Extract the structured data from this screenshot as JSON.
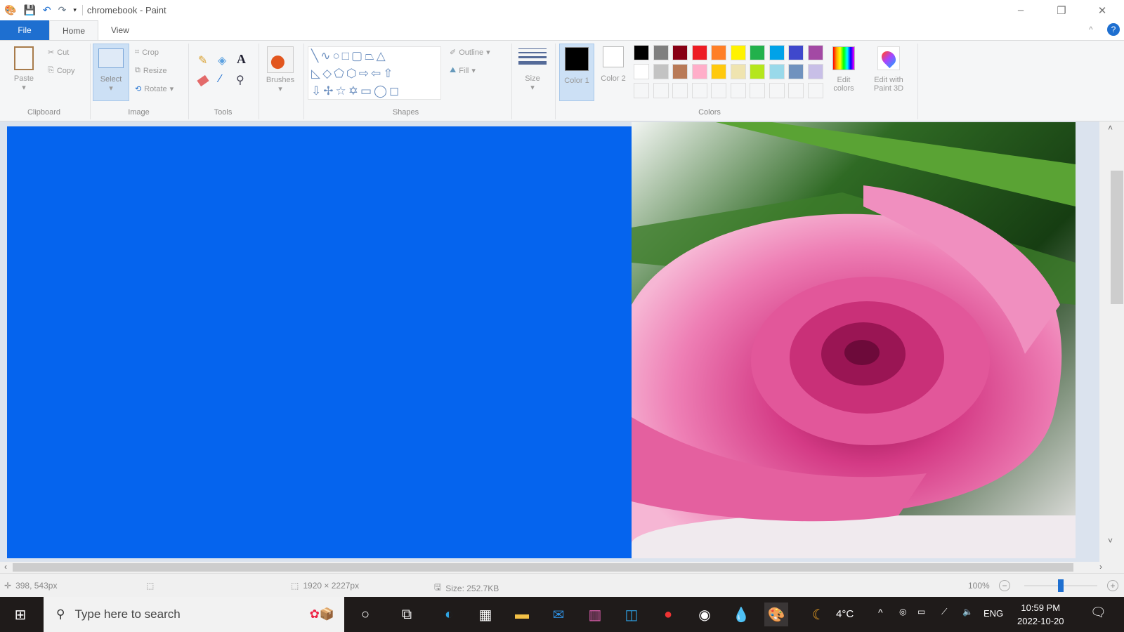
{
  "window": {
    "title": "chromebook - Paint"
  },
  "tabs": [
    "File",
    "Home",
    "View"
  ],
  "clipboard": {
    "paste": "Paste",
    "cut": "Cut",
    "copy": "Copy",
    "label": "Clipboard"
  },
  "image": {
    "select": "Select",
    "crop": "Crop",
    "resize": "Resize",
    "rotate": "Rotate",
    "label": "Image"
  },
  "tools": {
    "label": "Tools"
  },
  "brushes": {
    "label": "Brushes"
  },
  "shapes": {
    "outline": "Outline",
    "fill": "Fill",
    "label": "Shapes"
  },
  "size": {
    "label": "Size"
  },
  "colors": {
    "color1": "Color 1",
    "color2": "Color 2",
    "edit": "Edit colors",
    "paint3d": "Edit with Paint 3D",
    "label": "Colors",
    "palette_row1": [
      "#000000",
      "#7f7f7f",
      "#880015",
      "#ed1c24",
      "#ff7f27",
      "#fff200",
      "#22b14c",
      "#00a2e8",
      "#3f48cc",
      "#a349a4"
    ],
    "palette_row2": [
      "#ffffff",
      "#c3c3c3",
      "#b97a57",
      "#ffaec9",
      "#ffc90e",
      "#efe4b0",
      "#b5e61d",
      "#99d9ea",
      "#7092be",
      "#c8bfe7"
    ]
  },
  "status": {
    "cursor": "398, 543px",
    "dimensions": "1920 × 2227px",
    "size": "Size: 252.7KB",
    "zoom": "100%",
    "zoom_fraction": 0.5
  },
  "taskbar": {
    "search_placeholder": "Type here to search",
    "weather": "4°C",
    "lang": "ENG",
    "time": "10:59 PM",
    "date": "2022-10-20"
  }
}
